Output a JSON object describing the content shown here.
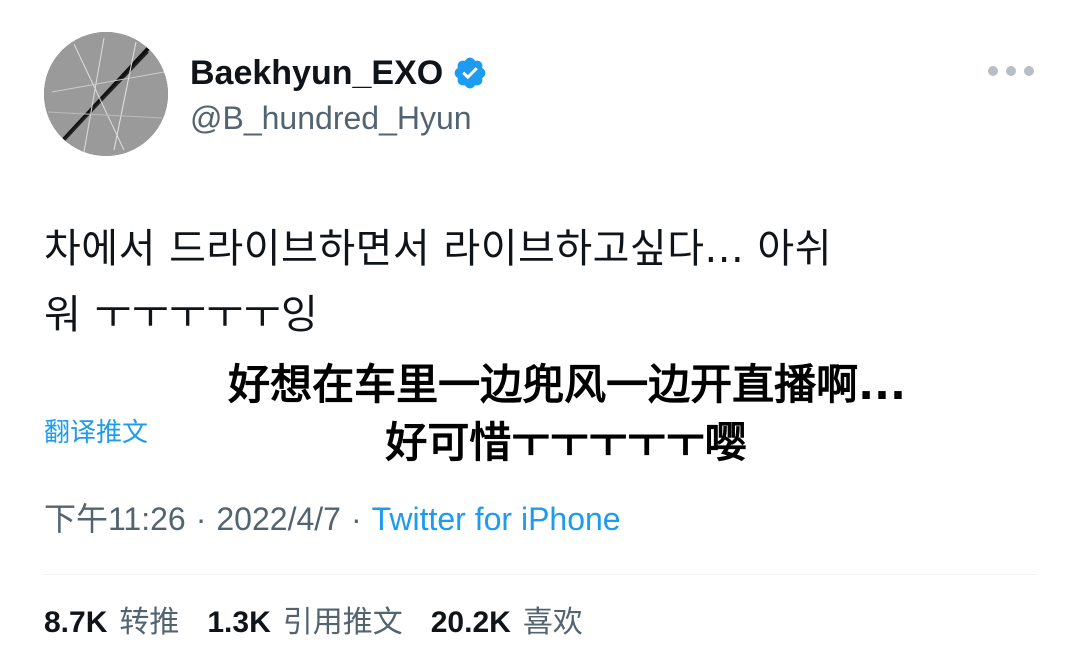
{
  "author": {
    "display_name": "Baekhyun_EXO",
    "handle": "@B_hundred_Hyun",
    "verified": true,
    "verified_icon": "verified-badge-icon",
    "avatar_icon": "avatar-image"
  },
  "more_icon": "more-options-icon",
  "tweet": {
    "text_line_1": "차에서 드라이브하면서 라이브하고싶다... 아쉬",
    "text_line_2": "워 ㅜㅜㅜㅜㅜ잉",
    "translate_label": "翻译推文"
  },
  "caption": {
    "line_1": "好想在车里一边兜风一边开直播啊...",
    "line_2": "好可惜ㅜㅜㅜㅜㅜ嘤"
  },
  "meta": {
    "time": "下午11:26",
    "separator": "·",
    "date": "2022/4/7",
    "source": "Twitter for iPhone"
  },
  "stats": {
    "retweets_count": "8.7K",
    "retweets_label": "转推",
    "quotes_count": "1.3K",
    "quotes_label": "引用推文",
    "likes_count": "20.2K",
    "likes_label": "喜欢"
  },
  "colors": {
    "link": "#1d9bf0",
    "secondary": "#536471",
    "primary_text": "#0f1419"
  }
}
